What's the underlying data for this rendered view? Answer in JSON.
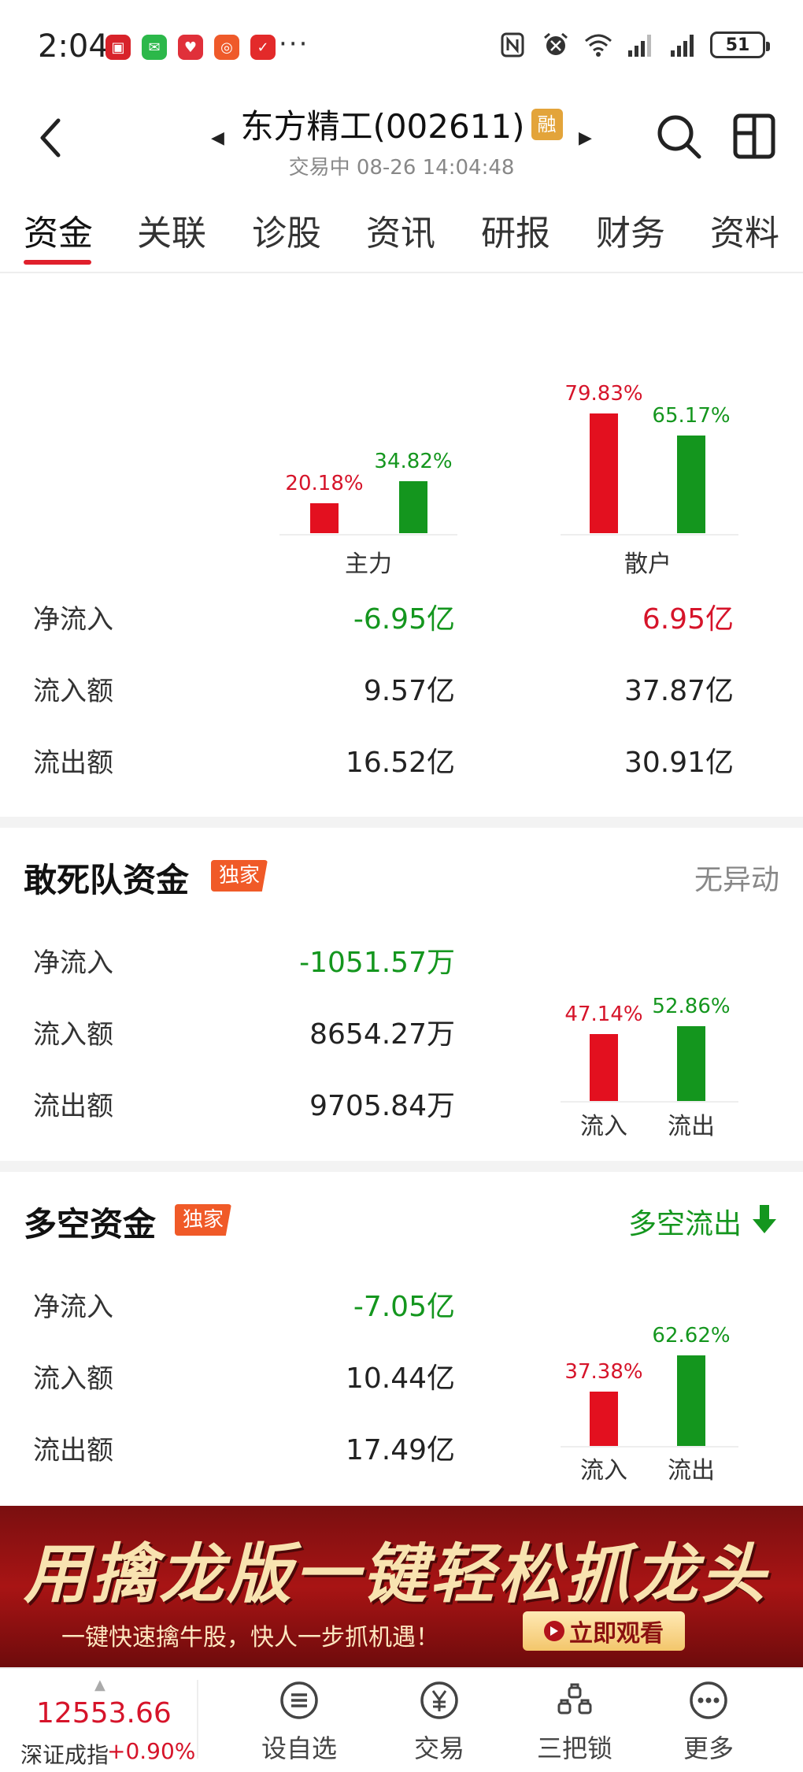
{
  "status_bar": {
    "time": "2:04",
    "dots": "···",
    "battery": "51"
  },
  "header": {
    "stock_title": "东方精工(002611)",
    "badge": "融",
    "subtitle": "交易中 08-26 14:04:48"
  },
  "tabs": [
    "资金",
    "关联",
    "诊股",
    "资讯",
    "研报",
    "财务",
    "资料"
  ],
  "main_retail": {
    "chart_data": {
      "type": "bar",
      "categories": [
        "主力",
        "散户"
      ],
      "series": [
        {
          "values": [
            20.18,
            79.83
          ]
        },
        {
          "values": [
            34.82,
            65.17
          ]
        }
      ],
      "labels": [
        [
          "20.18%",
          "34.82%"
        ],
        [
          "79.83%",
          "65.17%"
        ]
      ],
      "colors": [
        "#e3101f",
        "#14961e"
      ],
      "ylim": [
        0,
        100
      ]
    },
    "rows": [
      {
        "label": "净流入",
        "main": "-6.95亿",
        "retail": "6.95亿"
      },
      {
        "label": "流入额",
        "main": "9.57亿",
        "retail": "37.87亿"
      },
      {
        "label": "流出额",
        "main": "16.52亿",
        "retail": "30.91亿"
      }
    ]
  },
  "dare_to_die": {
    "title": "敢死队资金",
    "badge": "独家",
    "status": "无异动",
    "rows": [
      {
        "label": "净流入",
        "value": "-1051.57万"
      },
      {
        "label": "流入额",
        "value": "8654.27万"
      },
      {
        "label": "流出额",
        "value": "9705.84万"
      }
    ],
    "chart_data": {
      "type": "bar",
      "categories": [
        "流入",
        "流出"
      ],
      "values": [
        47.14,
        52.86
      ],
      "labels": [
        "47.14%",
        "52.86%"
      ],
      "colors": [
        "#e3101f",
        "#14961e"
      ],
      "ylim": [
        0,
        100
      ]
    }
  },
  "long_short": {
    "title": "多空资金",
    "badge": "独家",
    "status": "多空流出",
    "status_icon": "arrow-down-icon",
    "rows": [
      {
        "label": "净流入",
        "value": "-7.05亿"
      },
      {
        "label": "流入额",
        "value": "10.44亿"
      },
      {
        "label": "流出额",
        "value": "17.49亿"
      }
    ],
    "chart_data": {
      "type": "bar",
      "categories": [
        "流入",
        "流出"
      ],
      "values": [
        37.38,
        62.62
      ],
      "labels": [
        "37.38%",
        "62.62%"
      ],
      "colors": [
        "#e3101f",
        "#14961e"
      ],
      "ylim": [
        0,
        100
      ]
    }
  },
  "banner": {
    "headline": "用擒龙版一键轻松抓龙头",
    "subline": "一键快速擒牛股，快人一步抓机遇！",
    "button": "立即观看"
  },
  "bottom_bar": {
    "index_value": "12553.66",
    "index_name": "深证成指",
    "index_change": "+0.90%",
    "nav": [
      "设自选",
      "交易",
      "三把锁",
      "更多"
    ]
  }
}
